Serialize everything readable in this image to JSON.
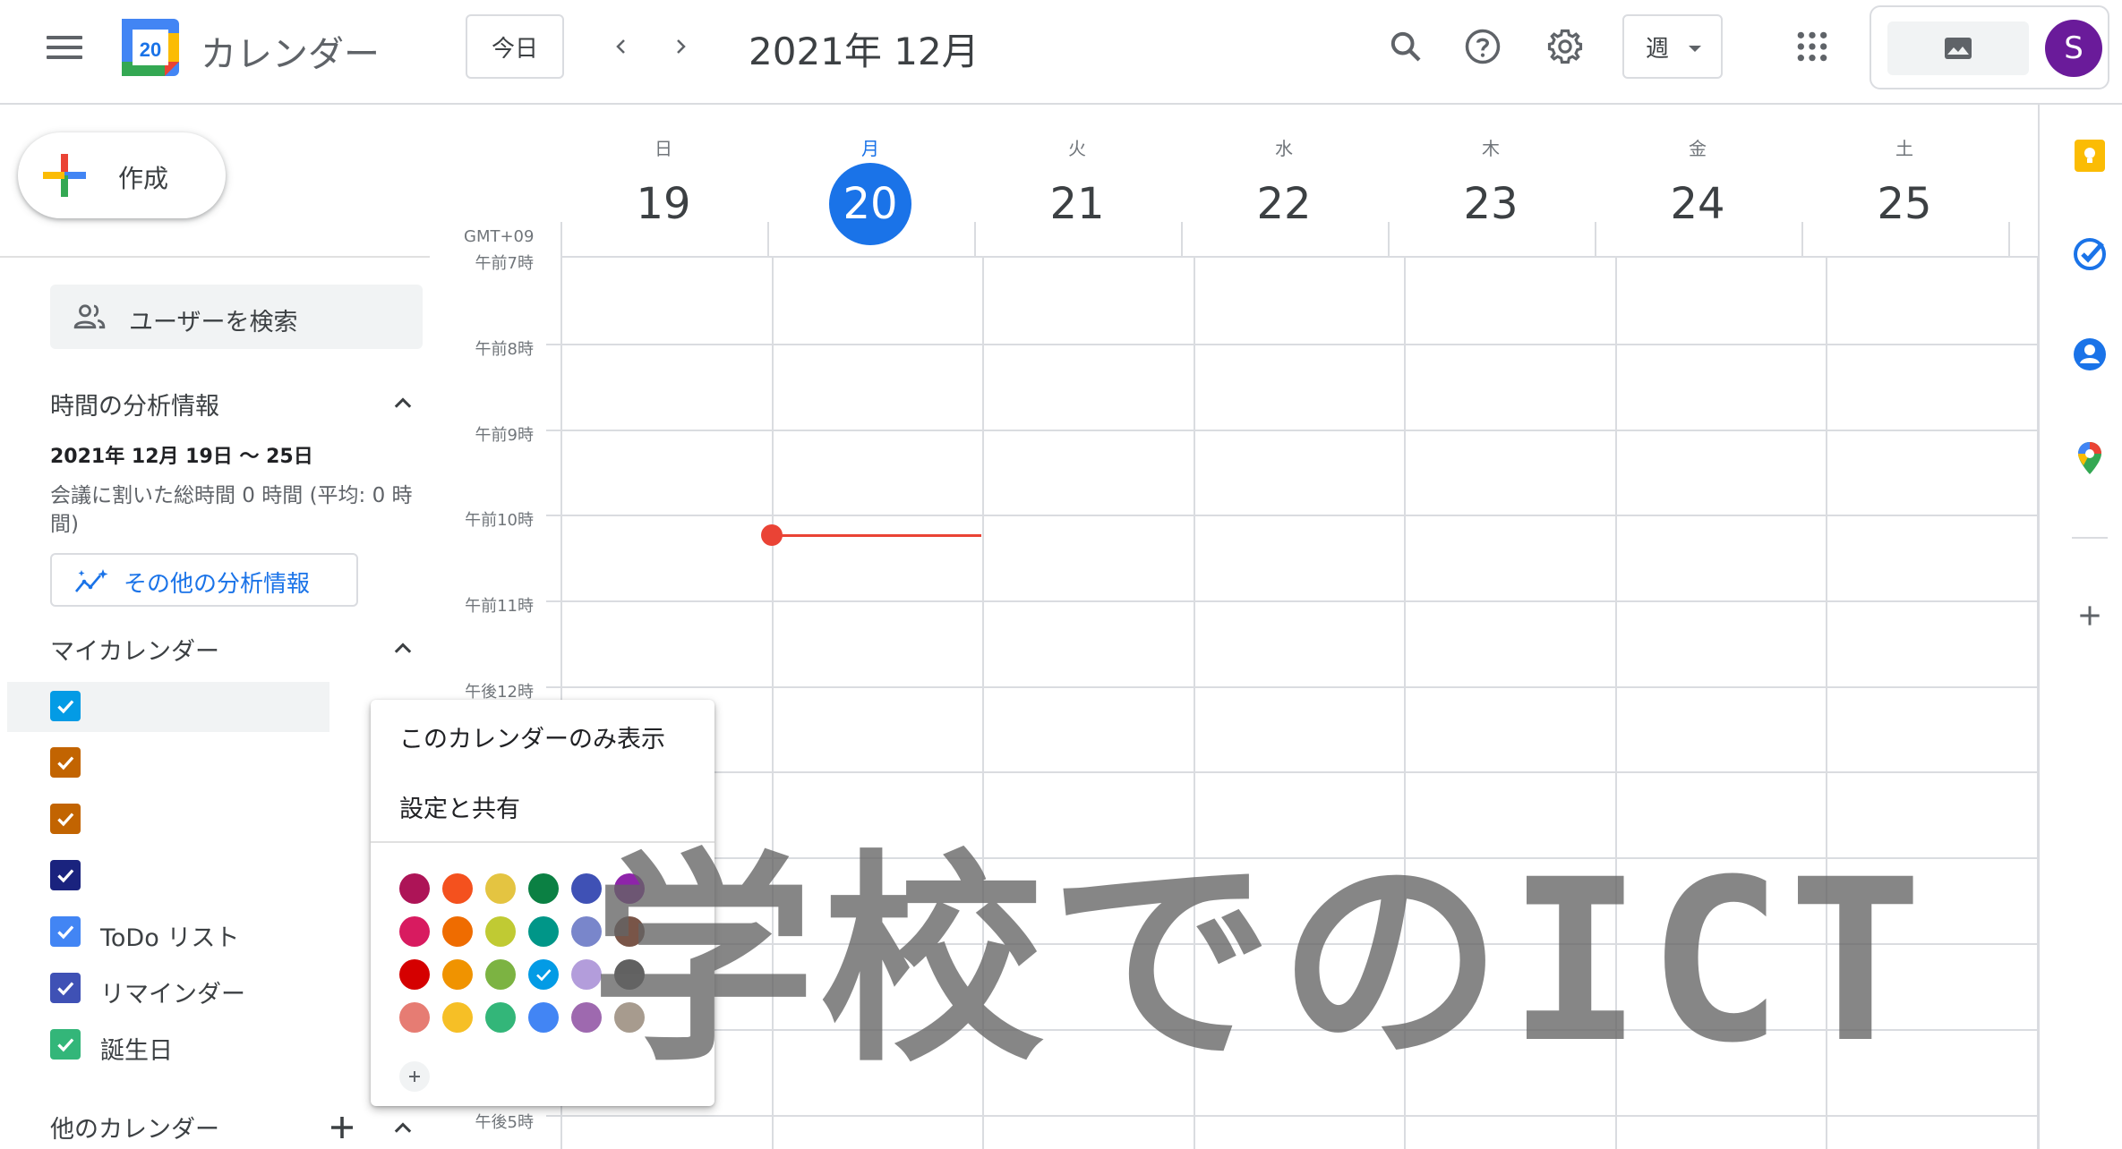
{
  "header": {
    "app_name": "カレンダー",
    "logo_day": "20",
    "today_label": "今日",
    "date_title": "2021年 12月",
    "view_label": "週",
    "avatar_initial": "S"
  },
  "sidebar": {
    "create_label": "作成",
    "search_users_label": "ユーザーを検索",
    "insights": {
      "title": "時間の分析情報",
      "range": "2021年 12月 19日 〜 25日",
      "meeting_text": "会議に割いた総時間 0 時間 (平均: 0 時間)",
      "more_label": "その他の分析情報"
    },
    "my_calendars_title": "マイカレンダー",
    "my_calendars": [
      {
        "label": "",
        "color": "#039be5"
      },
      {
        "label": "",
        "color": "#c26401"
      },
      {
        "label": "",
        "color": "#c26401"
      },
      {
        "label": "",
        "color": "#1a237e"
      },
      {
        "label": "ToDo リスト",
        "color": "#4285f4"
      },
      {
        "label": "リマインダー",
        "color": "#3f51b5"
      },
      {
        "label": "誕生日",
        "color": "#33b679"
      }
    ],
    "other_calendars_title": "他のカレンダー"
  },
  "grid": {
    "timezone": "GMT+09",
    "days": [
      {
        "dow": "日",
        "num": "19",
        "active": false
      },
      {
        "dow": "月",
        "num": "20",
        "active": true
      },
      {
        "dow": "火",
        "num": "21",
        "active": false
      },
      {
        "dow": "水",
        "num": "22",
        "active": false
      },
      {
        "dow": "木",
        "num": "23",
        "active": false
      },
      {
        "dow": "金",
        "num": "24",
        "active": false
      },
      {
        "dow": "土",
        "num": "25",
        "active": false
      }
    ],
    "time_labels": [
      "午前7時",
      "午前8時",
      "午前9時",
      "午前10時",
      "午前11時",
      "午後12時",
      "午後5時"
    ]
  },
  "popup": {
    "only_this_label": "このカレンダーのみ表示",
    "settings_label": "設定と共有",
    "colors": [
      [
        "#ad1457",
        "#f4511e",
        "#e4c441",
        "#0b8043",
        "#3f51b5",
        "#8e24aa"
      ],
      [
        "#d81b60",
        "#ef6c00",
        "#c0ca33",
        "#009688",
        "#7986cb",
        "#795548"
      ],
      [
        "#d50000",
        "#f09300",
        "#7cb342",
        "#039be5",
        "#b39ddb",
        "#616161"
      ],
      [
        "#e67c73",
        "#f6bf26",
        "#33b679",
        "#4285f4",
        "#9e69af",
        "#a79b8e"
      ]
    ],
    "selected_color": "#039be5"
  },
  "watermark": "学校でのICT"
}
